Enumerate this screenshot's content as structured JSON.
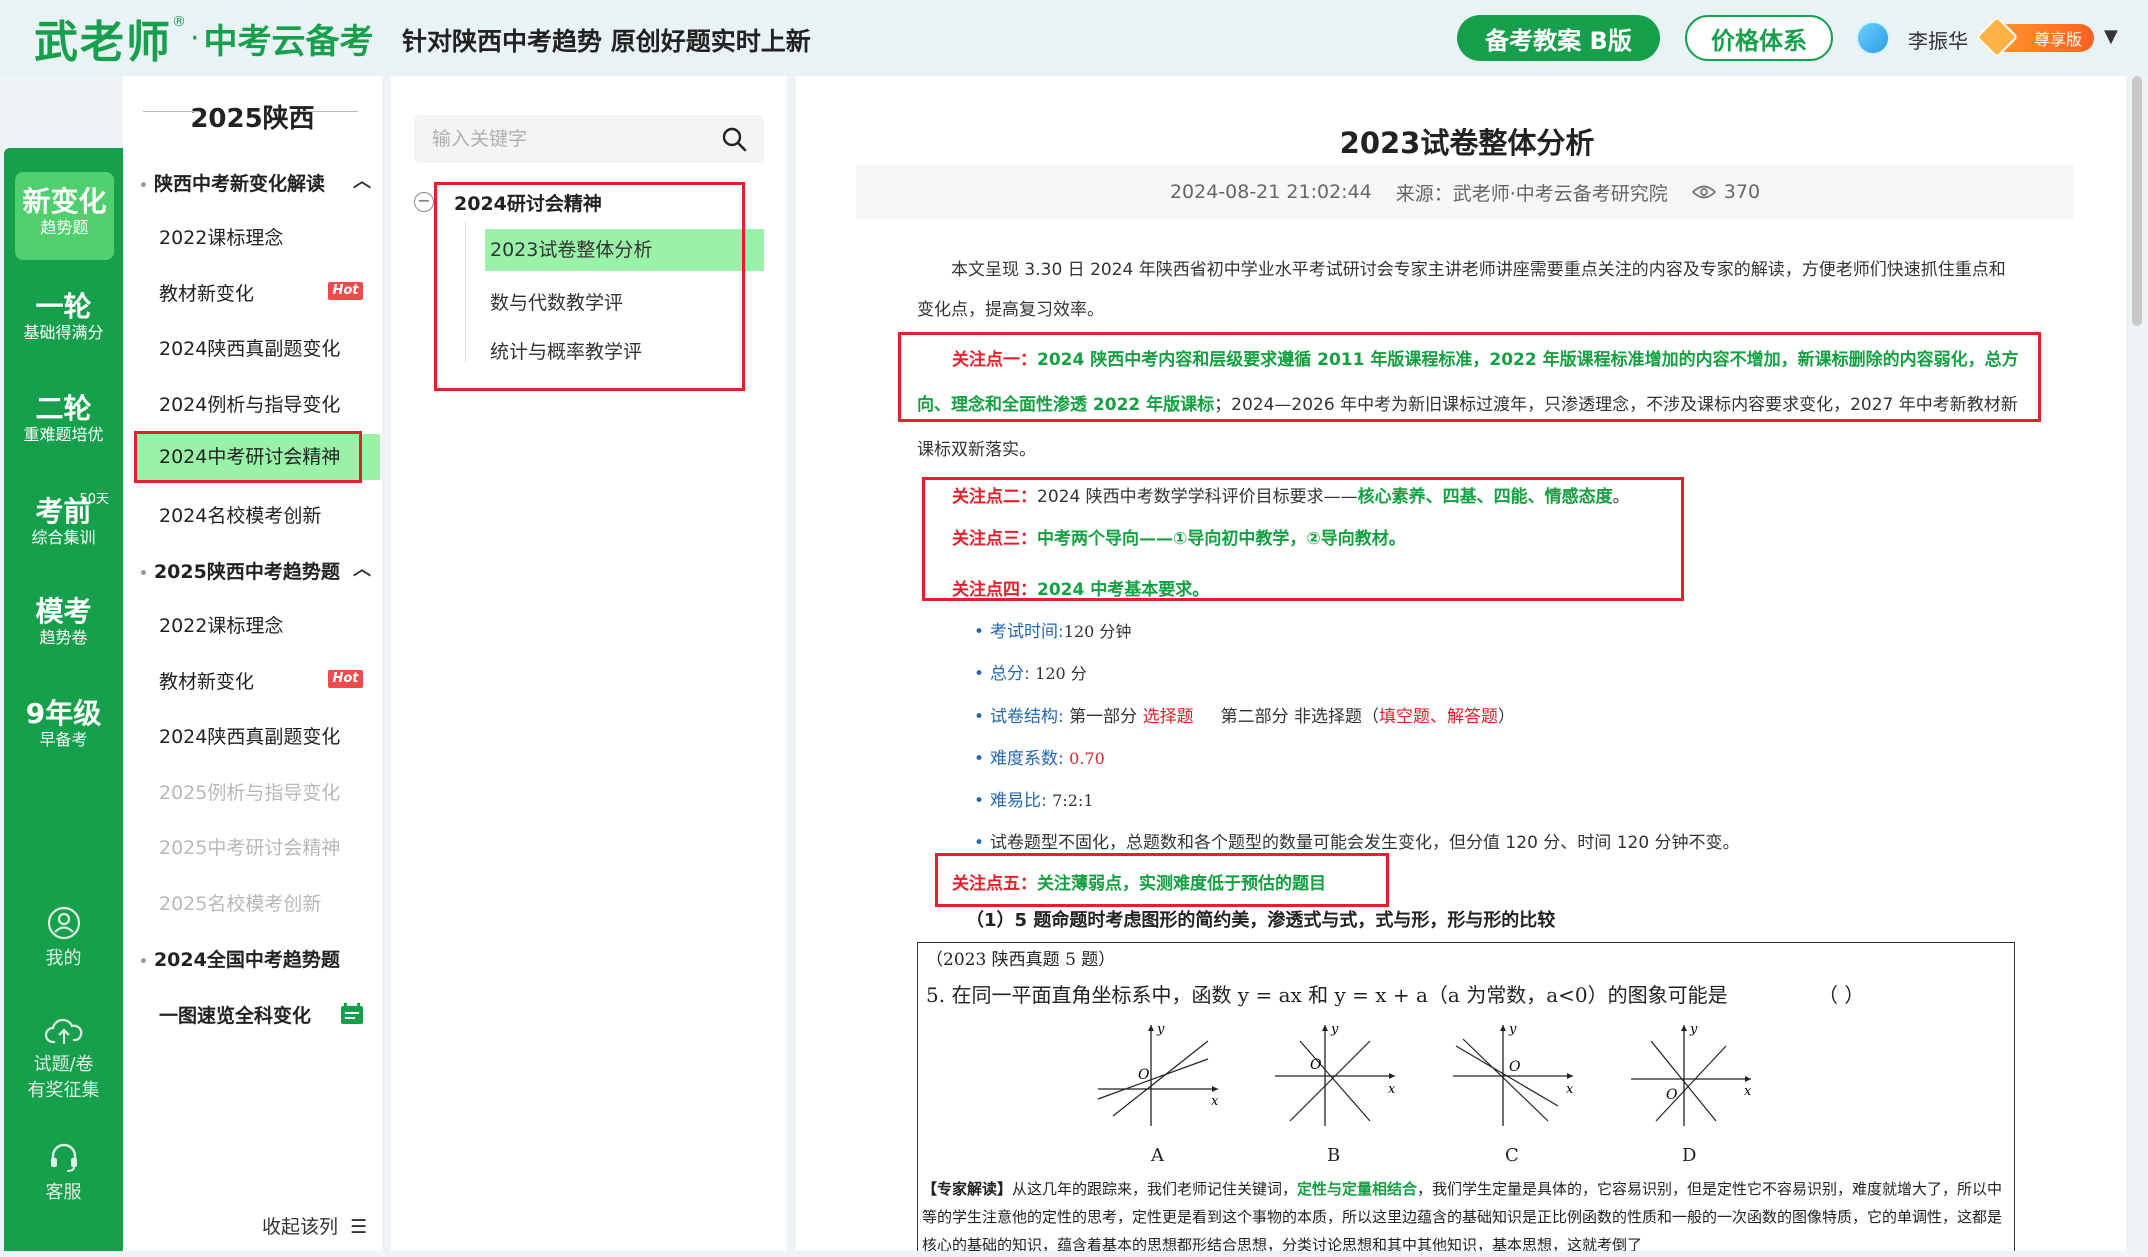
{
  "header": {
    "logo_main": "武老师",
    "logo_reg": "®",
    "logo_dot": "·",
    "logo_sub": "中考云备考",
    "slogan": "针对陕西中考趋势 原创好题实时上新",
    "plan_button": "备考教案 B版",
    "price_button": "价格体系",
    "user_name": "李振华",
    "vip_label": "尊享版"
  },
  "rail": {
    "items": [
      {
        "big": "新变化",
        "small": "趋势题"
      },
      {
        "big": "一轮",
        "small": "基础得满分"
      },
      {
        "big": "二轮",
        "small": "重难题培优"
      },
      {
        "big": "考前",
        "small": "综合集训",
        "badge": "50天"
      },
      {
        "big": "模考",
        "small": "趋势卷"
      },
      {
        "big": "9年级",
        "small": "早备考"
      }
    ],
    "bottom": [
      {
        "label": "我的",
        "icon": "user-icon"
      },
      {
        "label": "试题/卷",
        "label2": "有奖征集",
        "icon": "upload-cloud-icon"
      },
      {
        "label": "客服",
        "icon": "headset-icon"
      }
    ]
  },
  "nav": {
    "header": "2025陕西",
    "sections": [
      {
        "title": "陕西中考新变化解读",
        "items": [
          "2022课标理念",
          "教材新变化",
          "2024陕西真副题变化",
          "2024例析与指导变化",
          "2024中考研讨会精神",
          "2024名校模考创新"
        ]
      },
      {
        "title": "2025陕西中考趋势题",
        "items": [
          "2022课标理念",
          "教材新变化",
          "2024陕西真副题变化",
          "2025例析与指导变化",
          "2025中考研讨会精神",
          "2025名校模考创新"
        ]
      },
      {
        "title": "2024全国中考趋势题",
        "items": [
          "一图速览全科变化"
        ]
      }
    ],
    "hot": "Hot",
    "collapse": "收起该列"
  },
  "middle": {
    "search_placeholder": "输入关键字",
    "tree_root": "2024研讨会精神",
    "tree_items": [
      "2023试卷整体分析",
      "数与代数教学评",
      "统计与概率教学评"
    ]
  },
  "article": {
    "title": "2023试卷整体分析",
    "date": "2024-08-21 21:02:44",
    "source": "来源：武老师·中考云备考研究院",
    "views": "370",
    "intro": "本文呈现 3.30 日 2024 年陕西省初中学业水平考试研讨会专家主讲老师讲座需要重点关注的内容及专家的解读，方便老师们快速抓住重点和变化点，提高复习效率。",
    "p1_label": "关注点一：",
    "p1_green": "2024 陕西中考内容和层级要求遵循 2011 年版课程标准，2022 年版课程标准增加的内容不增加，新课标删除的内容弱化，总方向、理念和全面性渗透 2022 年版课标",
    "p1_rest": "；2024—2026 年中考为新旧课标过渡年，只渗透理念，不涉及课标内容要求变化，2027 年中考新教材新课标双新落实。",
    "p2_label": "关注点二：",
    "p2_text": "2024 陕西中考数学学科评价目标要求——",
    "p2_green": "核心素养、四基、四能、情感态度",
    "p2_end": "。",
    "p3_label": "关注点三：",
    "p3_green": "中考两个导向——①导向初中教学，②导向教材。",
    "p4_label": "关注点四：",
    "p4_green": "2024 中考基本要求。",
    "bullets": [
      {
        "label": "考试时间:",
        "value": "120 分钟"
      },
      {
        "label": "总分:",
        "value": "120 分"
      },
      {
        "label": "试卷结构:",
        "part1": "第一部分",
        "red1": "选择题",
        "part2": "第二部分  非选择题（",
        "red2": "填空题、解答题",
        "part3": "）"
      },
      {
        "label": "难度系数:",
        "value": "0.70"
      },
      {
        "label": "难易比:",
        "value": "7:2:1"
      },
      {
        "value": "试卷题型不固化，总题数和各个题型的数量可能会发生变化，但分值 120 分、时间 120 分钟不变。"
      }
    ],
    "p5_label": "关注点五：",
    "p5_green": "关注薄弱点，实测难度低于预估的题目",
    "sub_head": "（1）5 题命题时考虑图形的简约美，渗透式与式，式与形，形与形的比较",
    "exam": {
      "source": "（2023 陕西真题 5 题）",
      "question": "5.  在同一平面直角坐标系中，函数 y = ax 和 y = x + a（a 为常数，a<0）的图象可能是",
      "paren": "（      ）",
      "options": [
        "A",
        "B",
        "C",
        "D"
      ],
      "axis_x": "x",
      "axis_y": "y",
      "origin": "O",
      "expert_label": "【专家解读】",
      "expert_1": "从这几年的跟踪来，我们老师记住关键词，",
      "expert_green": "定性与定量相结合",
      "expert_2": "，我们学生定量是具体的，它容易识别，但是定性它不容易识别，难度就增大了，所以中等的学生注意他的定性的思考，定性更是看到这个事物的本质，所以这里边蕴含的基础知识是正比例函数的性质和一般的一次函数的图像特质，它的单调性，这都是核心的基础的知识，蕴含着基本的思想都形结合思想，分类讨论思想和其中其他知识，基本思想，这就考倒了"
    }
  }
}
